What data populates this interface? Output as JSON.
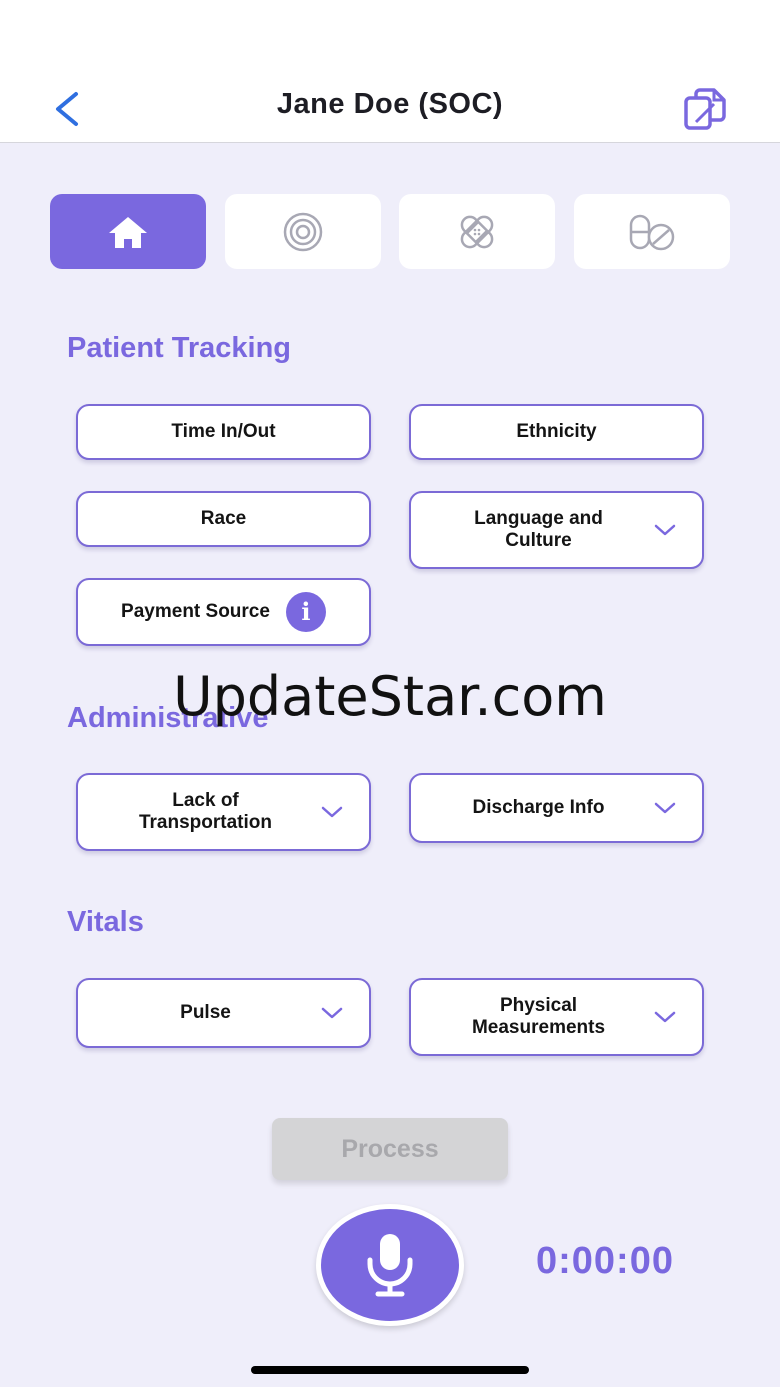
{
  "header": {
    "title": "Jane Doe (SOC)",
    "back_icon": "chevron-left-icon",
    "copy_icon": "copy-documents-icon"
  },
  "tabs": [
    {
      "icon": "home-icon",
      "active": true
    },
    {
      "icon": "target-icon",
      "active": false
    },
    {
      "icon": "bandage-icon",
      "active": false
    },
    {
      "icon": "pills-icon",
      "active": false
    }
  ],
  "sections": {
    "patient_tracking": {
      "title": "Patient Tracking",
      "time_in_out": "Time In/Out",
      "ethnicity": "Ethnicity",
      "race": "Race",
      "language_and_culture": "Language and Culture",
      "payment_source": "Payment Source",
      "info_glyph": "i"
    },
    "administrative": {
      "title": "Administrative",
      "lack_of_transportation": "Lack of Transportation",
      "discharge_info": "Discharge Info"
    },
    "vitals": {
      "title": "Vitals",
      "pulse": "Pulse",
      "physical_measurements": "Physical Measurements"
    }
  },
  "footer": {
    "process_label": "Process",
    "timer": "0:00:00",
    "mic_icon": "microphone-icon"
  },
  "watermark": "UpdateStar.com",
  "colors": {
    "accent": "#7a68df",
    "background": "#efeefa",
    "button_border": "#7b6ad6",
    "disabled": "#d4d4d6"
  }
}
